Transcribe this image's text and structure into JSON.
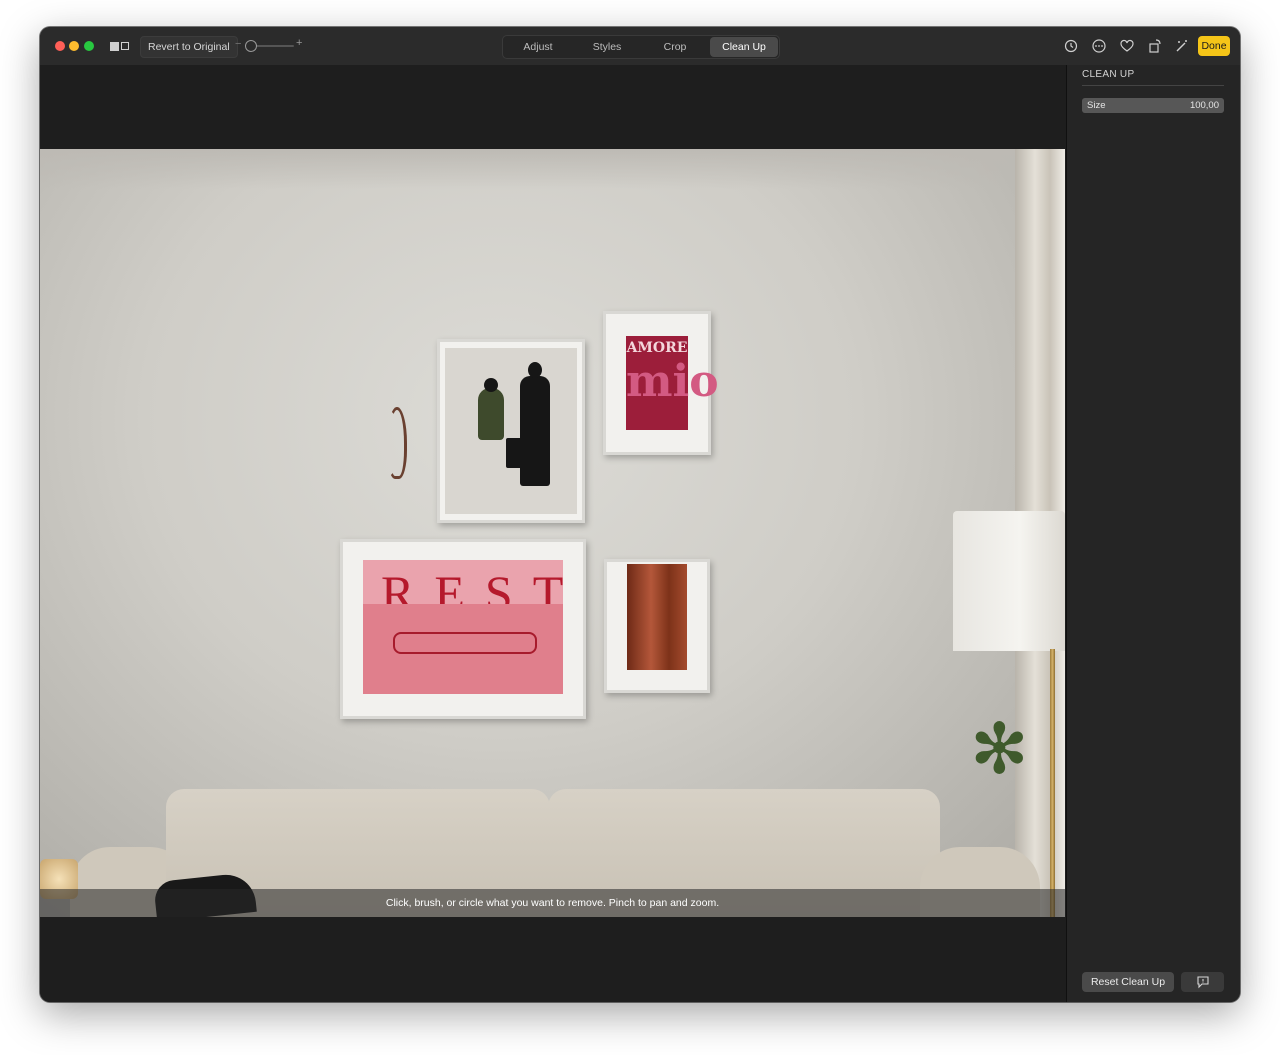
{
  "toolbar": {
    "revert_label": "Revert to Original",
    "zoom_minus": "−",
    "zoom_plus": "+",
    "tabs": [
      {
        "label": "Adjust",
        "active": false
      },
      {
        "label": "Styles",
        "active": false
      },
      {
        "label": "Crop",
        "active": false
      },
      {
        "label": "Clean Up",
        "active": true
      }
    ],
    "icons": [
      "rotate-history-icon",
      "more-options-icon",
      "favorite-heart-icon",
      "rotate-icon",
      "magic-wand-icon"
    ],
    "done_label": "Done"
  },
  "photo": {
    "poster_amore_line1": "AMORE",
    "poster_amore_line2": "mio",
    "poster_rest": "REST"
  },
  "canvas": {
    "hint": "Click, brush, or circle what you want to remove. Pinch to pan and zoom."
  },
  "sidebar": {
    "title": "CLEAN UP",
    "size_label": "Size",
    "size_value": "100,00",
    "reset_label": "Reset Clean Up"
  },
  "colors": {
    "done_button": "#f5c518",
    "window_bg": "#1e1e1e"
  }
}
